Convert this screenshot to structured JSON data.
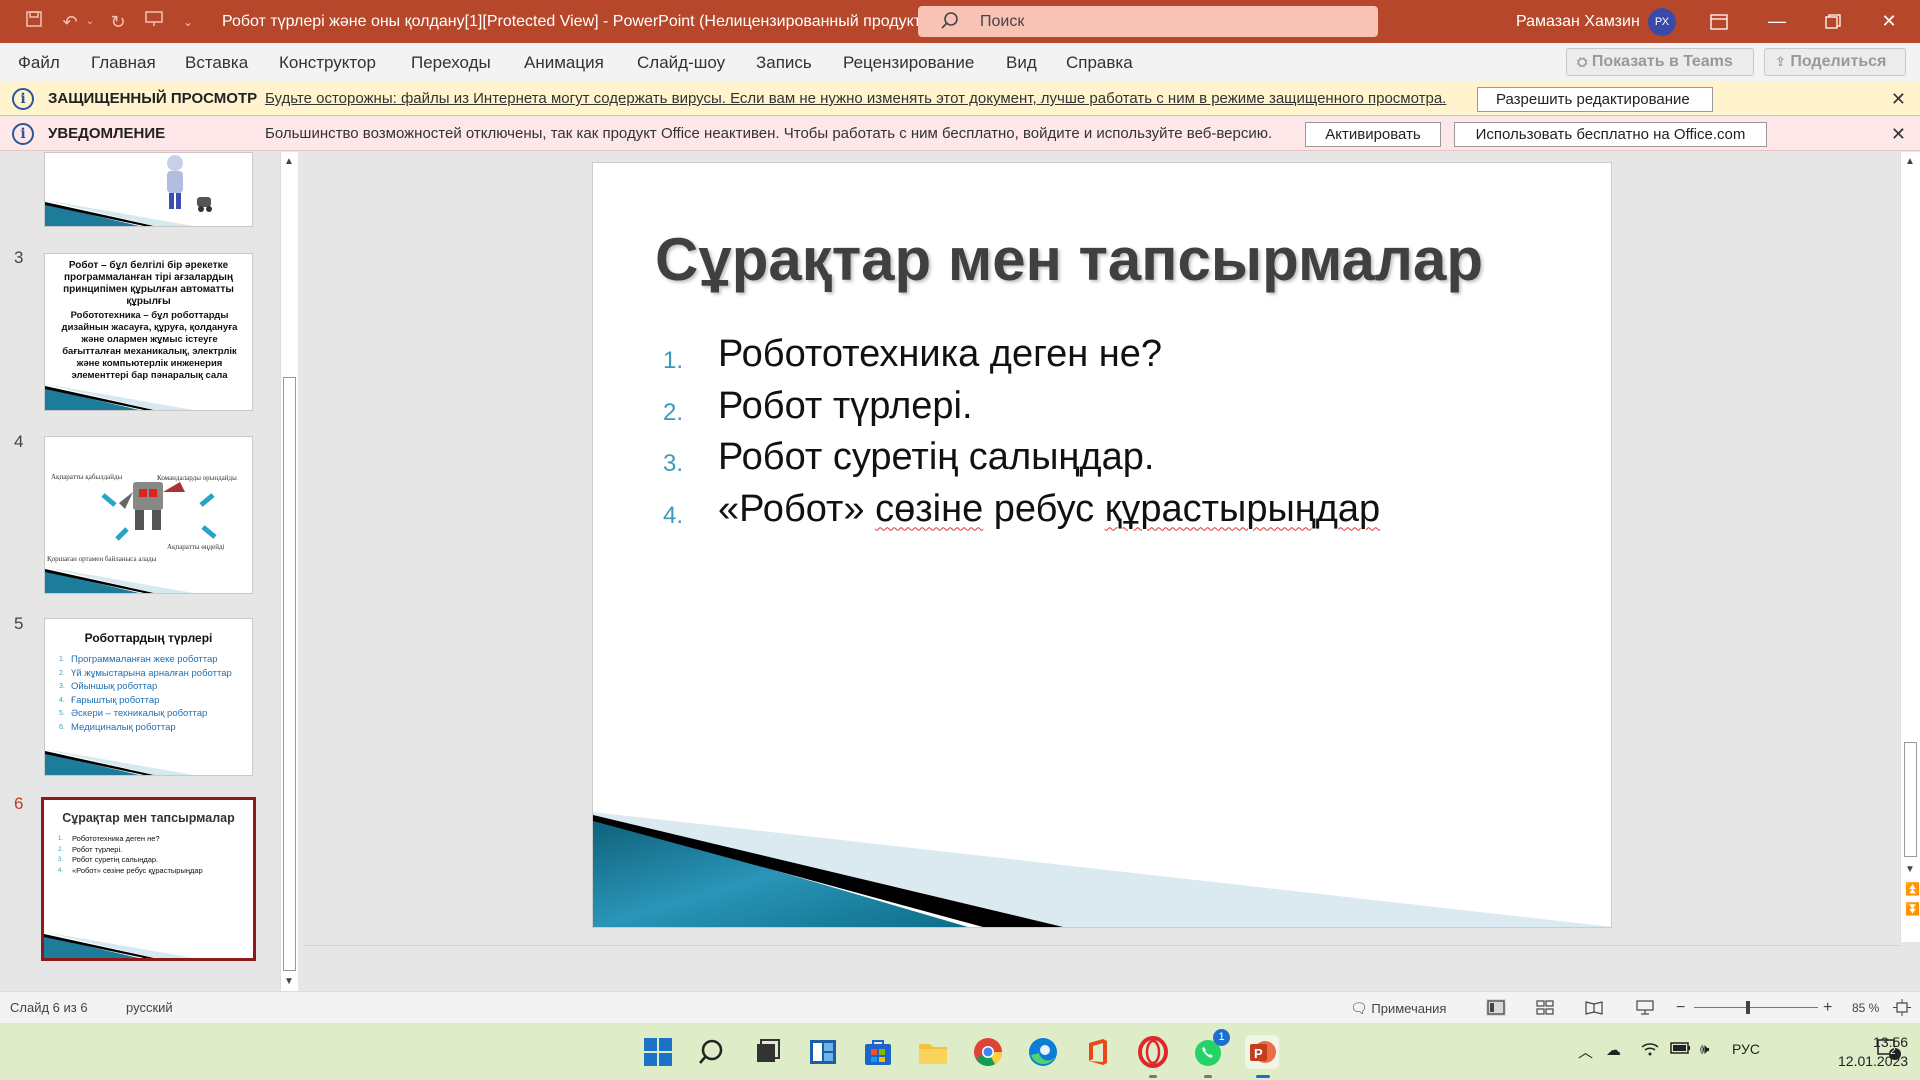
{
  "titlebar": {
    "doc_title": "Робот түрлері және оны қолдану[1][Protected View]  -  PowerPoint (Нелицензированный продукт)",
    "search_placeholder": "Поиск",
    "user_name": "Рамазан Хамзин",
    "avatar_initials": "РХ",
    "accent_color": "#b7472a"
  },
  "menu": {
    "items": [
      "Файл",
      "Главная",
      "Вставка",
      "Конструктор",
      "Переходы",
      "Анимация",
      "Слайд-шоу",
      "Запись",
      "Рецензирование",
      "Вид",
      "Справка"
    ],
    "teams_button": "Показать в Teams",
    "share_button": "Поделиться"
  },
  "protected_bar": {
    "title": "ЗАЩИЩЕННЫЙ ПРОСМОТР",
    "message": "Будьте осторожны: файлы из Интернета могут содержать вирусы. Если вам не нужно изменять этот документ, лучше работать с ним в режиме защищенного просмотра.",
    "button": "Разрешить редактирование"
  },
  "notice_bar": {
    "title": "УВЕДОМЛЕНИЕ",
    "message": "Большинство возможностей отключены, так как продукт Office неактивен. Чтобы работать с ним бесплатно, войдите и используйте веб-версию.",
    "activate_button": "Активировать",
    "free_button": "Использовать бесплатно на Office.com"
  },
  "thumbnails": {
    "slide3": {
      "number": "3",
      "title": "Робот – бұл белгілі бір әрекетке программаланған тірі ағзалардың принципімен құрылған автоматты құрылғы",
      "body": "Робототехника – бұл роботтарды дизайнын жасауға, құруға, қолдануға және олармен жұмыс істеуге бағытталған механикалық, электрлік және компьютерлік инженерия элементтері бар пәнаралық сала"
    },
    "slide4": {
      "number": "4",
      "label_top_left": "Ақпаратты қабылдайды",
      "label_top_right": "Командаларды орындайды",
      "label_bottom_right": "Ақпаратты өңдейді",
      "label_bottom_left": "Қоршаған ортамен байланыса алады"
    },
    "slide5": {
      "number": "5",
      "title": "Роботтардың түрлері",
      "items": [
        "Программаланған жеке роботтар",
        "Үй жұмыстарына арналған роботтар",
        "Ойыншық роботтар",
        "Ғарыштық роботтар",
        "Әскери – техникалық роботтар",
        "Медициналық роботтар"
      ]
    },
    "slide6": {
      "number": "6",
      "title": "Сұрақтар мен тапсырмалар",
      "items": [
        "Робототехника деген не?",
        "Робот түрлері.",
        "Робот суретің салыңдар.",
        "«Робот» сөзіне ребус құрастырыңдар"
      ]
    }
  },
  "slide": {
    "title": "Сұрақтар мен тапсырмалар",
    "items": [
      {
        "n": "1.",
        "text": "Робототехника деген не?"
      },
      {
        "n": "2.",
        "text": "Робот түрлері."
      },
      {
        "n": "3.",
        "text": "Робот суретің салыңдар."
      },
      {
        "n": "4.",
        "text_a": "«Робот» ",
        "text_b": "сөзіне",
        "text_c": " ребус ",
        "text_d": "құрастырыңдар"
      }
    ]
  },
  "statusbar": {
    "slide_counter": "Слайд 6 из 6",
    "language": "русский",
    "notes": "Примечания",
    "zoom": "85 %"
  },
  "taskbar": {
    "lang": "РУС",
    "time": "13:56",
    "date": "12.01.2023",
    "whatsapp_badge": "1",
    "notification_count": "2"
  }
}
